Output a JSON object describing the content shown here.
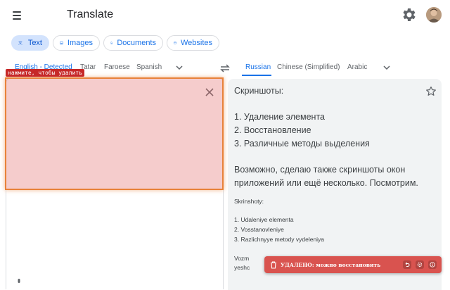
{
  "header": {
    "title": "Translate"
  },
  "modes": [
    {
      "label": "Text",
      "active": true
    },
    {
      "label": "Images"
    },
    {
      "label": "Documents"
    },
    {
      "label": "Websites"
    }
  ],
  "source_langs": [
    "English - Detected",
    "Tatar",
    "Faroese",
    "Spanish"
  ],
  "target_langs": [
    "Russian",
    "Chinese (Simplified)",
    "Arabic"
  ],
  "overlay": {
    "hint": "нажмите, чтобы удалить"
  },
  "translation": {
    "lines": [
      "Скриншоты:",
      "1. Удаление элемента",
      "2. Восстановление",
      "3. Различные методы выделения",
      "Возможно, сделаю также скриншоты окон",
      "приложений или ещё несколько. Посмотрим."
    ],
    "translit": [
      "Skrinshoty:",
      "1. Udaleniye elementa",
      "2. Vosstanovleniye",
      "3. Razlichnyye metody vydeleniya",
      "Vozm",
      "yeshc"
    ]
  },
  "toast": {
    "text": "УДАЛЕНО: можно восстановить"
  },
  "colors": {
    "accent": "#1a73e8",
    "toast": "#d9534f",
    "highlight_border": "#e8823a",
    "hint_tag": "#c62828"
  }
}
